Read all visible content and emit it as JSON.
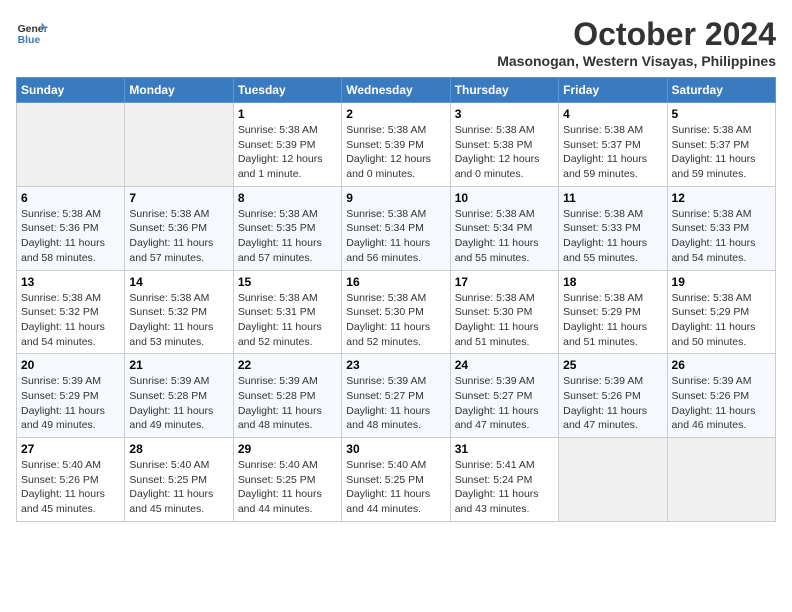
{
  "header": {
    "logo_line1": "General",
    "logo_line2": "Blue",
    "month": "October 2024",
    "location": "Masonogan, Western Visayas, Philippines"
  },
  "weekdays": [
    "Sunday",
    "Monday",
    "Tuesday",
    "Wednesday",
    "Thursday",
    "Friday",
    "Saturday"
  ],
  "weeks": [
    [
      {
        "day": "",
        "sunrise": "",
        "sunset": "",
        "daylight": ""
      },
      {
        "day": "",
        "sunrise": "",
        "sunset": "",
        "daylight": ""
      },
      {
        "day": "1",
        "sunrise": "Sunrise: 5:38 AM",
        "sunset": "Sunset: 5:39 PM",
        "daylight": "Daylight: 12 hours and 1 minute."
      },
      {
        "day": "2",
        "sunrise": "Sunrise: 5:38 AM",
        "sunset": "Sunset: 5:39 PM",
        "daylight": "Daylight: 12 hours and 0 minutes."
      },
      {
        "day": "3",
        "sunrise": "Sunrise: 5:38 AM",
        "sunset": "Sunset: 5:38 PM",
        "daylight": "Daylight: 12 hours and 0 minutes."
      },
      {
        "day": "4",
        "sunrise": "Sunrise: 5:38 AM",
        "sunset": "Sunset: 5:37 PM",
        "daylight": "Daylight: 11 hours and 59 minutes."
      },
      {
        "day": "5",
        "sunrise": "Sunrise: 5:38 AM",
        "sunset": "Sunset: 5:37 PM",
        "daylight": "Daylight: 11 hours and 59 minutes."
      }
    ],
    [
      {
        "day": "6",
        "sunrise": "Sunrise: 5:38 AM",
        "sunset": "Sunset: 5:36 PM",
        "daylight": "Daylight: 11 hours and 58 minutes."
      },
      {
        "day": "7",
        "sunrise": "Sunrise: 5:38 AM",
        "sunset": "Sunset: 5:36 PM",
        "daylight": "Daylight: 11 hours and 57 minutes."
      },
      {
        "day": "8",
        "sunrise": "Sunrise: 5:38 AM",
        "sunset": "Sunset: 5:35 PM",
        "daylight": "Daylight: 11 hours and 57 minutes."
      },
      {
        "day": "9",
        "sunrise": "Sunrise: 5:38 AM",
        "sunset": "Sunset: 5:34 PM",
        "daylight": "Daylight: 11 hours and 56 minutes."
      },
      {
        "day": "10",
        "sunrise": "Sunrise: 5:38 AM",
        "sunset": "Sunset: 5:34 PM",
        "daylight": "Daylight: 11 hours and 55 minutes."
      },
      {
        "day": "11",
        "sunrise": "Sunrise: 5:38 AM",
        "sunset": "Sunset: 5:33 PM",
        "daylight": "Daylight: 11 hours and 55 minutes."
      },
      {
        "day": "12",
        "sunrise": "Sunrise: 5:38 AM",
        "sunset": "Sunset: 5:33 PM",
        "daylight": "Daylight: 11 hours and 54 minutes."
      }
    ],
    [
      {
        "day": "13",
        "sunrise": "Sunrise: 5:38 AM",
        "sunset": "Sunset: 5:32 PM",
        "daylight": "Daylight: 11 hours and 54 minutes."
      },
      {
        "day": "14",
        "sunrise": "Sunrise: 5:38 AM",
        "sunset": "Sunset: 5:32 PM",
        "daylight": "Daylight: 11 hours and 53 minutes."
      },
      {
        "day": "15",
        "sunrise": "Sunrise: 5:38 AM",
        "sunset": "Sunset: 5:31 PM",
        "daylight": "Daylight: 11 hours and 52 minutes."
      },
      {
        "day": "16",
        "sunrise": "Sunrise: 5:38 AM",
        "sunset": "Sunset: 5:30 PM",
        "daylight": "Daylight: 11 hours and 52 minutes."
      },
      {
        "day": "17",
        "sunrise": "Sunrise: 5:38 AM",
        "sunset": "Sunset: 5:30 PM",
        "daylight": "Daylight: 11 hours and 51 minutes."
      },
      {
        "day": "18",
        "sunrise": "Sunrise: 5:38 AM",
        "sunset": "Sunset: 5:29 PM",
        "daylight": "Daylight: 11 hours and 51 minutes."
      },
      {
        "day": "19",
        "sunrise": "Sunrise: 5:38 AM",
        "sunset": "Sunset: 5:29 PM",
        "daylight": "Daylight: 11 hours and 50 minutes."
      }
    ],
    [
      {
        "day": "20",
        "sunrise": "Sunrise: 5:39 AM",
        "sunset": "Sunset: 5:29 PM",
        "daylight": "Daylight: 11 hours and 49 minutes."
      },
      {
        "day": "21",
        "sunrise": "Sunrise: 5:39 AM",
        "sunset": "Sunset: 5:28 PM",
        "daylight": "Daylight: 11 hours and 49 minutes."
      },
      {
        "day": "22",
        "sunrise": "Sunrise: 5:39 AM",
        "sunset": "Sunset: 5:28 PM",
        "daylight": "Daylight: 11 hours and 48 minutes."
      },
      {
        "day": "23",
        "sunrise": "Sunrise: 5:39 AM",
        "sunset": "Sunset: 5:27 PM",
        "daylight": "Daylight: 11 hours and 48 minutes."
      },
      {
        "day": "24",
        "sunrise": "Sunrise: 5:39 AM",
        "sunset": "Sunset: 5:27 PM",
        "daylight": "Daylight: 11 hours and 47 minutes."
      },
      {
        "day": "25",
        "sunrise": "Sunrise: 5:39 AM",
        "sunset": "Sunset: 5:26 PM",
        "daylight": "Daylight: 11 hours and 47 minutes."
      },
      {
        "day": "26",
        "sunrise": "Sunrise: 5:39 AM",
        "sunset": "Sunset: 5:26 PM",
        "daylight": "Daylight: 11 hours and 46 minutes."
      }
    ],
    [
      {
        "day": "27",
        "sunrise": "Sunrise: 5:40 AM",
        "sunset": "Sunset: 5:26 PM",
        "daylight": "Daylight: 11 hours and 45 minutes."
      },
      {
        "day": "28",
        "sunrise": "Sunrise: 5:40 AM",
        "sunset": "Sunset: 5:25 PM",
        "daylight": "Daylight: 11 hours and 45 minutes."
      },
      {
        "day": "29",
        "sunrise": "Sunrise: 5:40 AM",
        "sunset": "Sunset: 5:25 PM",
        "daylight": "Daylight: 11 hours and 44 minutes."
      },
      {
        "day": "30",
        "sunrise": "Sunrise: 5:40 AM",
        "sunset": "Sunset: 5:25 PM",
        "daylight": "Daylight: 11 hours and 44 minutes."
      },
      {
        "day": "31",
        "sunrise": "Sunrise: 5:41 AM",
        "sunset": "Sunset: 5:24 PM",
        "daylight": "Daylight: 11 hours and 43 minutes."
      },
      {
        "day": "",
        "sunrise": "",
        "sunset": "",
        "daylight": ""
      },
      {
        "day": "",
        "sunrise": "",
        "sunset": "",
        "daylight": ""
      }
    ]
  ]
}
